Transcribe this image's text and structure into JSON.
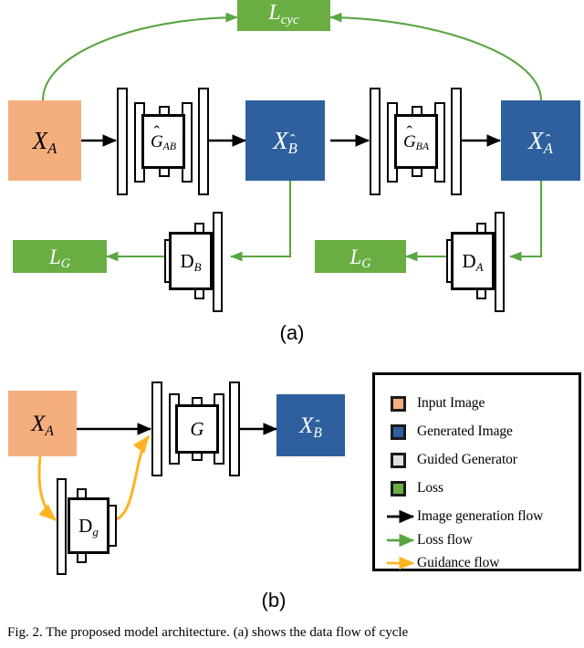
{
  "figure": {
    "caption_label": "Fig. 2.",
    "caption_text": "The proposed model architecture. (a) shows the data flow of cycle"
  },
  "panel_a": {
    "caption": "(a)",
    "loss_cyc": "L_cyc",
    "nodes": {
      "x_a": "X_A",
      "x_b_hat": "X_B̂",
      "x_a_hat": "X_Â",
      "gen_ab": "Ĝ_AB",
      "gen_ba": "Ĝ_BA",
      "disc_b": "D_B",
      "disc_a": "D_A",
      "loss_g_left": "L_G",
      "loss_g_right": "L_G"
    }
  },
  "panel_b": {
    "caption": "(b)",
    "nodes": {
      "x_a": "X_A",
      "x_b_hat": "X_B̂",
      "generator": "G",
      "disc_g": "D_g"
    }
  },
  "legend": {
    "items": [
      {
        "type": "swatch",
        "swatch": "peach",
        "label": "Input Image"
      },
      {
        "type": "swatch",
        "swatch": "blue",
        "label": "Generated Image"
      },
      {
        "type": "swatch",
        "swatch": "gray",
        "label": "Guided Generator"
      },
      {
        "type": "swatch",
        "swatch": "green",
        "label": "Loss"
      },
      {
        "type": "arrow",
        "arrow": "black",
        "label": "Image generation flow"
      },
      {
        "type": "arrow",
        "arrow": "green",
        "label": "Loss flow"
      },
      {
        "type": "arrow",
        "arrow": "amber",
        "label": "Guidance flow"
      }
    ]
  },
  "colors": {
    "input_image": "#F4AE7E",
    "generated_image": "#2E5F9E",
    "guided_generator": "#E0E0E0",
    "loss": "#6AAE43",
    "image_flow": "#000000",
    "loss_flow": "#5AA544",
    "guidance_flow": "#FFB320"
  }
}
